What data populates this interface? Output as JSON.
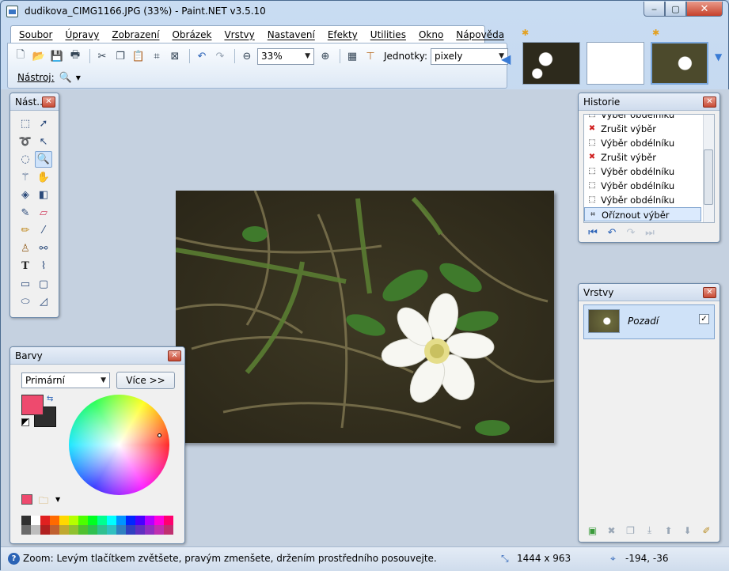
{
  "window": {
    "title": "dudikova_CIMG1166.JPG (33%) - Paint.NET v3.5.10",
    "min": "‒",
    "max": "▢",
    "close": "✕"
  },
  "menu": [
    "Soubor",
    "Úpravy",
    "Zobrazení",
    "Obrázek",
    "Vrstvy",
    "Nastavení",
    "Efekty",
    "Utilities",
    "Okno",
    "Nápověda"
  ],
  "toolbar": {
    "zoom": "33%",
    "units_label": "Jednotky:",
    "units": "pixely",
    "tool_label": "Nástroj:"
  },
  "tools_panel": {
    "title": "Nást...",
    "close": "✕"
  },
  "history_panel": {
    "title": "Historie",
    "close": "✕",
    "items": [
      {
        "label": "Výběr obdélníku",
        "icon": "rect-select-icon"
      },
      {
        "label": "Zrušit výběr",
        "icon": "deselect-icon"
      },
      {
        "label": "Výběr obdélníku",
        "icon": "rect-select-icon"
      },
      {
        "label": "Zrušit výběr",
        "icon": "deselect-icon"
      },
      {
        "label": "Výběr obdélníku",
        "icon": "rect-select-icon"
      },
      {
        "label": "Výběr obdélníku",
        "icon": "rect-select-icon"
      },
      {
        "label": "Výběr obdélníku",
        "icon": "rect-select-icon"
      },
      {
        "label": "Oříznout výběr",
        "icon": "crop-icon"
      }
    ]
  },
  "layers_panel": {
    "title": "Vrstvy",
    "close": "✕",
    "layer_name": "Pozadí",
    "layer_visible": "✓"
  },
  "colors_panel": {
    "title": "Barvy",
    "close": "✕",
    "mode": "Primární",
    "more_button": "Více >>",
    "primary_color": "#ee4a6e",
    "secondary_color": "#2e2e2e",
    "palette": [
      "#303030",
      "#ffffff",
      "#e02020",
      "#ff6a00",
      "#ffd800",
      "#b6ff00",
      "#4cff00",
      "#00ff21",
      "#00ff90",
      "#00ffff",
      "#0094ff",
      "#0026ff",
      "#4800ff",
      "#b200ff",
      "#ff00dc",
      "#ff006e",
      "#6a6a6a",
      "#bdbdbd",
      "#b02020",
      "#c06030",
      "#c0a830",
      "#90c030",
      "#50c030",
      "#30c050",
      "#30c090",
      "#30c0c0",
      "#3080c0",
      "#3040c0",
      "#6030c0",
      "#9030c0",
      "#c030b0",
      "#c03070"
    ]
  },
  "status": {
    "text": "Zoom: Levým tlačítkem zvětšete, pravým zmenšete, držením prostředního posouvejte.",
    "image_size": "1444 x 963",
    "coords": "-194, -36"
  }
}
